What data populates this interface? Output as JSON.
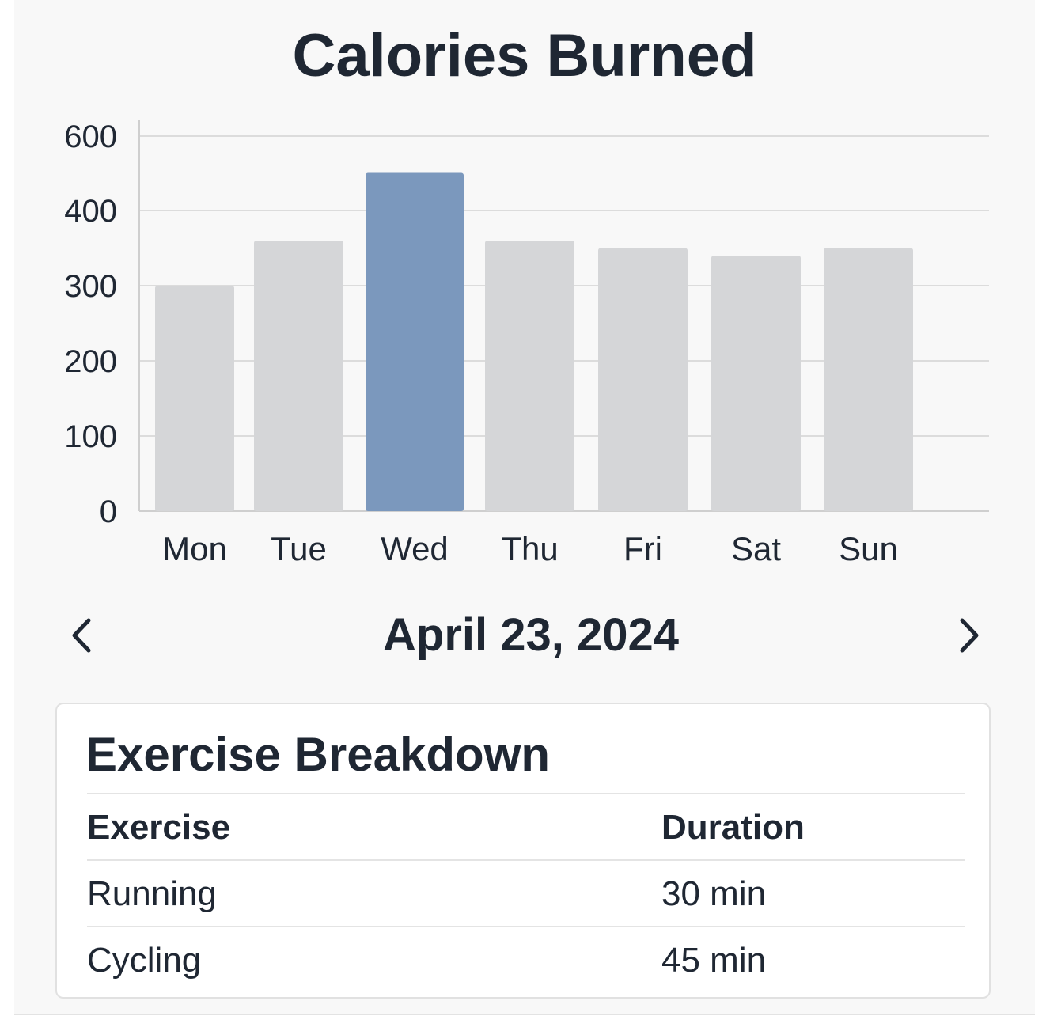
{
  "page": {
    "title": "Calories Burned"
  },
  "chart_data": {
    "type": "bar",
    "title": "Calories Burned",
    "categories": [
      "Mon",
      "Tue",
      "Wed",
      "Thu",
      "Fri",
      "Sat",
      "Sun"
    ],
    "values": [
      300,
      360,
      450,
      360,
      350,
      340,
      350
    ],
    "y_ticks": [
      "0",
      "100",
      "200",
      "300",
      "400",
      "600"
    ],
    "highlighted_category": "Wed",
    "grid": true,
    "colors": {
      "bar": "#d5d6d8",
      "highlight": "#7b98bd",
      "grid": "#dcdcdc",
      "axis": "#cfcfcf",
      "text": "#1f2733"
    }
  },
  "date_nav": {
    "date": "April 23, 2024",
    "prev_icon": "chevron-left-icon",
    "next_icon": "chevron-right-icon"
  },
  "breakdown": {
    "title": "Exercise Breakdown",
    "columns": [
      "Exercise",
      "Duration"
    ],
    "rows": [
      {
        "exercise": "Running",
        "duration": "30 min"
      },
      {
        "exercise": "Cycling",
        "duration": "45 min"
      }
    ]
  }
}
